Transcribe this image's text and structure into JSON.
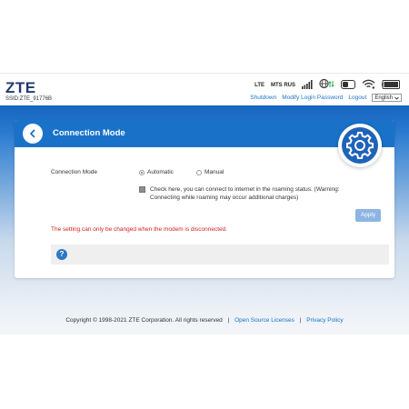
{
  "header": {
    "logo": "ZTE",
    "ssid": "SSID:ZTE_91776B",
    "network_type": "LTE",
    "operator": "MTS RUS",
    "links": {
      "shutdown": "Shutdown",
      "modify_password": "Modify Login Password",
      "logout": "Logout"
    },
    "language": "English"
  },
  "panel": {
    "title": "Connection Mode",
    "field_label": "Connection Mode",
    "options": [
      "Automatic",
      "Manual"
    ],
    "selected_option": "Automatic",
    "roaming_checkbox_text": "Check here, you can connect to internet in the roaming status. (Warning: Connecting while roaming may occur additional charges)",
    "roaming_checked": false,
    "apply_label": "Apply",
    "warning": "The setting can only be changed when the modem is disconnected.",
    "help_icon": "?"
  },
  "footer": {
    "copyright": "Copyright © 1998-2021 ZTE Corporation. All rights reserved",
    "open_source": "Open Source Licenses",
    "privacy": "Privacy Policy",
    "separator": "|"
  },
  "icons": {
    "signal": "signal-bars-icon",
    "globe": "globe-data-icon",
    "sms": "sms-icon",
    "wifi": "wifi-icon",
    "battery": "battery-icon",
    "gear": "gear-icon",
    "back": "back-arrow-icon"
  },
  "colors": {
    "brand_blue": "#1a72c8",
    "link_blue": "#1a73c9",
    "warning_red": "#d3221b",
    "apply_button": "#8db4e2",
    "data_green": "#2aa84a"
  }
}
